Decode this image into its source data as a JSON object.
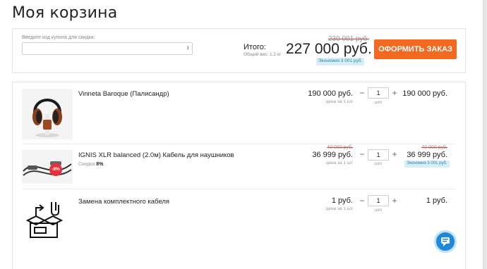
{
  "page": {
    "title": "Моя корзина"
  },
  "summary": {
    "coupon_label": "Введите код купона для скидки:",
    "coupon_value": "",
    "total_label": "Итого:",
    "weight_text": "Общий вес: 1.2 кг",
    "old_total": "230 001 руб.",
    "total": "227 000 руб.",
    "saving": "Экономия 3 001 руб.",
    "checkout_label": "ОФОРМИТЬ ЗАКАЗ",
    "accent_color": "#f26a21"
  },
  "items": [
    {
      "name": "Vinneta Baroque (Палисандр)",
      "unit_old": "",
      "unit_price": "190 000 руб.",
      "unit_caption": "цена за 1 шт",
      "qty": "1",
      "qty_caption": "шт",
      "sum_old": "",
      "sum_price": "190 000 руб.",
      "sum_saving": ""
    },
    {
      "name": "IGNIS XLR balanced (2.0м) Кабель для наушников",
      "discount_label": "Скидка",
      "discount_value": "8%",
      "badge": "-8%",
      "unit_old": "40 000 руб.",
      "unit_price": "36 999 руб.",
      "unit_caption": "цена за 1 шт",
      "qty": "1",
      "qty_caption": "шт",
      "sum_old": "40 000 руб.",
      "sum_price": "36 999 руб.",
      "sum_saving": "Экономия 3 001 руб."
    },
    {
      "name": "Замена комплектного кабеля",
      "unit_old": "",
      "unit_price": "1 руб.",
      "unit_caption": "цена за 1 шт",
      "qty": "1",
      "qty_caption": "шт",
      "sum_old": "",
      "sum_price": "1 руб.",
      "sum_saving": ""
    }
  ],
  "controls": {
    "minus": "−",
    "plus": "+"
  },
  "icons": {
    "coupon_submit": "chevron-right-icon",
    "chat": "chat-bubble-icon",
    "cable_swap": "cable-box-icon"
  }
}
